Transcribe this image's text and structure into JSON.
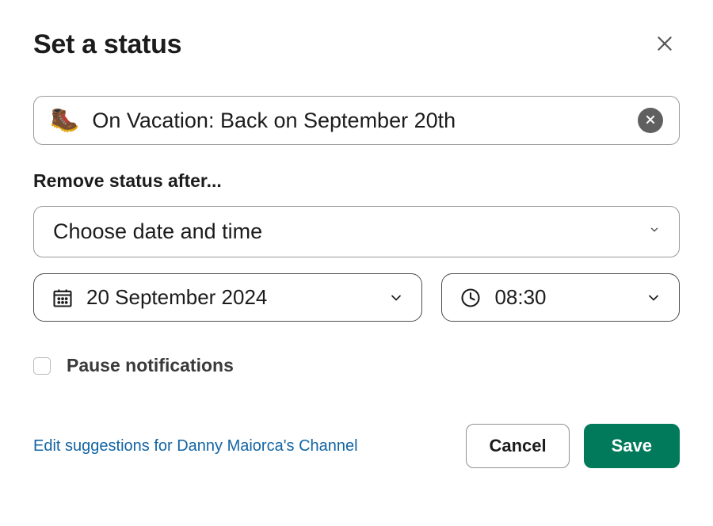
{
  "header": {
    "title": "Set a status"
  },
  "status": {
    "emoji": "🥾",
    "text": "On Vacation: Back on September 20th"
  },
  "remove_after": {
    "label": "Remove status after...",
    "selected": "Choose date and time",
    "date": "20 September 2024",
    "time": "08:30"
  },
  "pause": {
    "label": "Pause notifications",
    "checked": false
  },
  "footer": {
    "edit_link": "Edit suggestions for Danny Maiorca's Channel",
    "cancel": "Cancel",
    "save": "Save"
  }
}
